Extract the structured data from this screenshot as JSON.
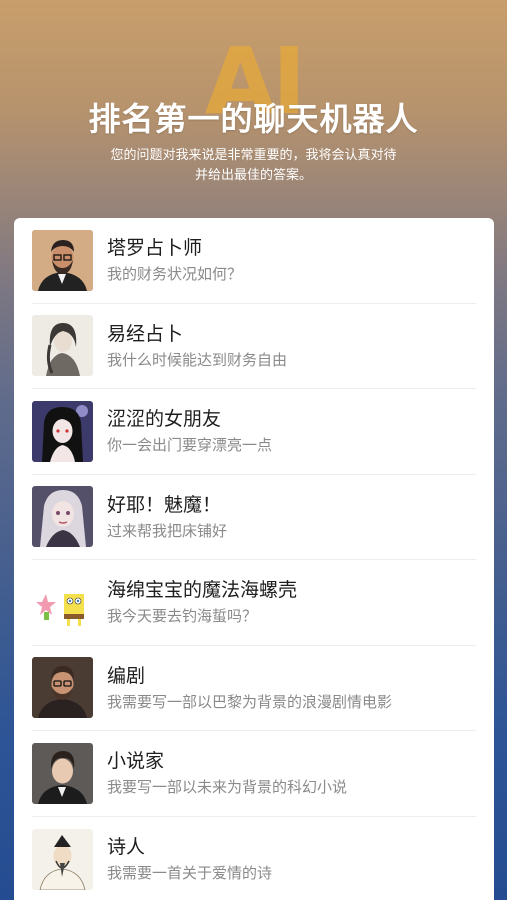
{
  "header": {
    "logo_text": "AI",
    "title": "排名第一的聊天机器人",
    "subtitle_line1": "您的问题对我来说是非常重要的，我将会认真对待",
    "subtitle_line2": "并给出最佳的答案。"
  },
  "bots": [
    {
      "name": "塔罗占卜师",
      "prompt": "我的财务状况如何？",
      "avatar": "bearded-man-glasses"
    },
    {
      "name": "易经占卜",
      "prompt": "我什么时候能达到财务自由",
      "avatar": "ink-painting-woman"
    },
    {
      "name": "涩涩的女朋友",
      "prompt": "你一会出门要穿漂亮一点",
      "avatar": "anime-girl"
    },
    {
      "name": "好耶！魅魔！",
      "prompt": "过来帮我把床铺好",
      "avatar": "fantasy-girl"
    },
    {
      "name": "海绵宝宝的魔法海螺壳",
      "prompt": "我今天要去钓海蜇吗？",
      "avatar": "spongebob-patrick"
    },
    {
      "name": "编剧",
      "prompt": "我需要写一部以巴黎为背景的浪漫剧情电影",
      "avatar": "man-glasses-beard"
    },
    {
      "name": "小说家",
      "prompt": "我要写一部以未来为背景的科幻小说",
      "avatar": "young-man-suit"
    },
    {
      "name": "诗人",
      "prompt": "我需要一首关于爱情的诗",
      "avatar": "ancient-poet"
    }
  ]
}
